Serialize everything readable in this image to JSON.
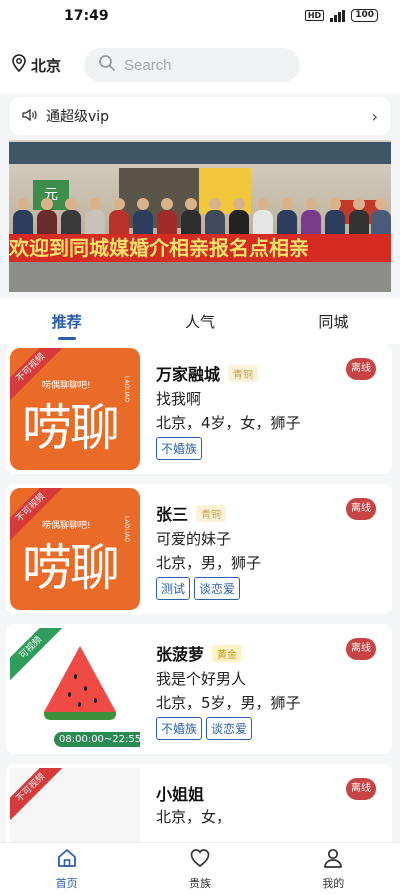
{
  "status_bar": {
    "time": "17:49",
    "network_badge": "HD",
    "battery": "100"
  },
  "header": {
    "location": "北京",
    "search_placeholder": "Search"
  },
  "notice": {
    "text": "通超级vip"
  },
  "banner": {
    "sign_text": "元",
    "banner_text": "欢迎到同城媒婚介相亲报名点相亲"
  },
  "tabs": [
    {
      "label": "推荐",
      "active": true
    },
    {
      "label": "人气",
      "active": false
    },
    {
      "label": "同城",
      "active": false
    }
  ],
  "cards": [
    {
      "ribbon": "不可视频",
      "logo_slogan": "唠偶聊聊吧!",
      "logo_text": "唠聊",
      "logo_vertical": "LAOLIAO",
      "name": "万家融城",
      "level": "青铜",
      "status": "离线",
      "motto": "找我啊",
      "info": "北京，4岁，女，狮子",
      "tags": [
        "不婚族"
      ]
    },
    {
      "ribbon": "不可视频",
      "logo_slogan": "唠偶聊聊吧!",
      "logo_text": "唠聊",
      "logo_vertical": "LAOLIAO",
      "name": "张三",
      "level": "青铜",
      "status": "离线",
      "motto": "可爱的妹子",
      "info": "北京，男，狮子",
      "tags": [
        "测试",
        "谈恋爱"
      ]
    },
    {
      "ribbon": "可视频",
      "time_range": "08:00:00~22:55:30",
      "name": "张菠萝",
      "level": "黄金",
      "status": "离线",
      "motto": "我是个好男人",
      "info": "北京，5岁，男，狮子",
      "tags": [
        "不婚族",
        "谈恋爱"
      ]
    },
    {
      "ribbon": "不可视频",
      "name": "小姐姐",
      "status": "离线",
      "info": "北京，女，"
    }
  ],
  "bottom_nav": [
    {
      "label": "首页",
      "icon": "home-icon",
      "active": true
    },
    {
      "label": "贵族",
      "icon": "heart-icon",
      "active": false
    },
    {
      "label": "我的",
      "icon": "user-icon",
      "active": false
    }
  ],
  "colors": {
    "accent": "#2b5fae",
    "offline": "#c84343",
    "orange": "#ea6a27"
  }
}
